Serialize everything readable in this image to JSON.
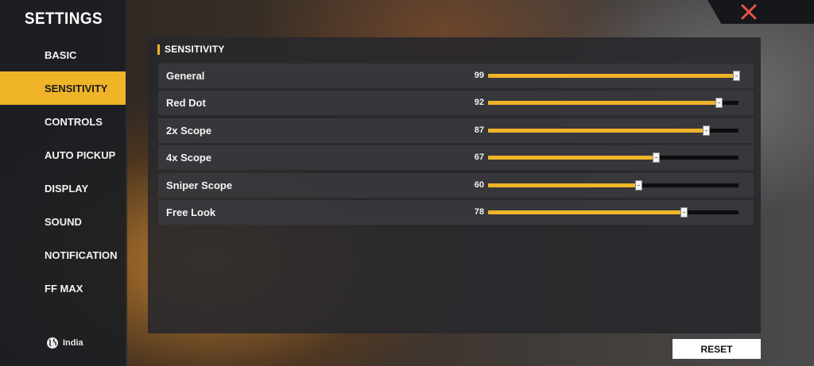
{
  "sidebar": {
    "title": "SETTINGS",
    "items": [
      {
        "label": "BASIC",
        "active": false
      },
      {
        "label": "SENSITIVITY",
        "active": true
      },
      {
        "label": "CONTROLS",
        "active": false
      },
      {
        "label": "AUTO PICKUP",
        "active": false
      },
      {
        "label": "DISPLAY",
        "active": false
      },
      {
        "label": "SOUND",
        "active": false
      },
      {
        "label": "NOTIFICATION",
        "active": false
      },
      {
        "label": "FF MAX",
        "active": false
      }
    ],
    "region": {
      "label": "India",
      "icon": "globe-icon"
    }
  },
  "close": {
    "icon": "close-icon",
    "color": "#e8533f"
  },
  "panel": {
    "title": "SENSITIVITY",
    "rows": [
      {
        "label": "General",
        "value": "99"
      },
      {
        "label": "Red Dot",
        "value": "92"
      },
      {
        "label": "2x Scope",
        "value": "87"
      },
      {
        "label": "4x Scope",
        "value": "67"
      },
      {
        "label": "Sniper Scope",
        "value": "60"
      },
      {
        "label": "Free Look",
        "value": "78"
      }
    ]
  },
  "reset_label": "RESET",
  "colors": {
    "accent": "#f0b429",
    "track": "#0d0d0f"
  }
}
